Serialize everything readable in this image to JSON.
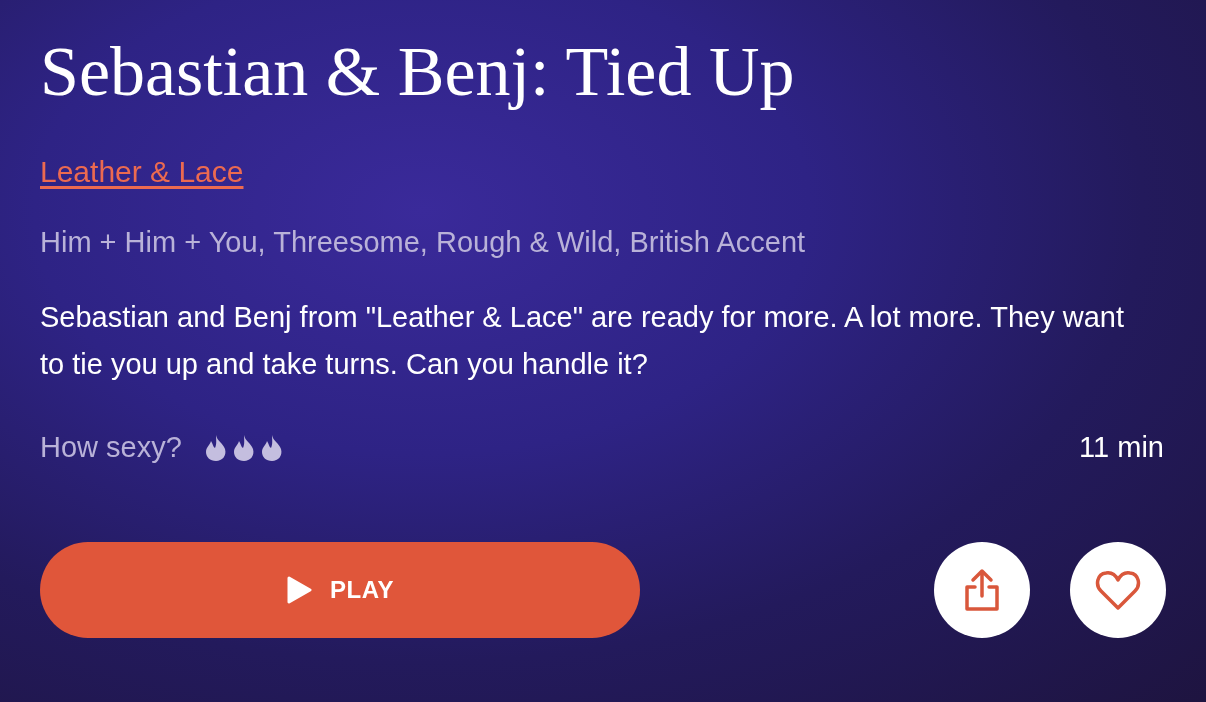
{
  "title": "Sebastian & Benj: Tied Up",
  "series_link": "Leather & Lace",
  "tags": "Him + Him + You, Threesome, Rough & Wild, British Accent",
  "description": "Sebastian and Benj from \"Leather & Lace\" are ready for more. A lot more. They want to tie you up and take turns. Can you handle it?",
  "heat": {
    "label": "How sexy?",
    "stars": 3
  },
  "duration": "11 min",
  "play_button": {
    "label": "PLAY"
  },
  "favorite": {
    "on": false
  }
}
